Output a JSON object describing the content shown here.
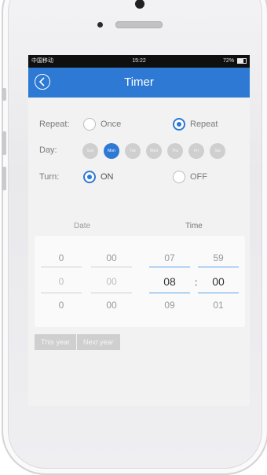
{
  "status_bar": {
    "carrier": "中国移动 ",
    "time": "15:22",
    "battery": "72%"
  },
  "nav": {
    "title": "Timer",
    "back_icon": "chevron-left-icon"
  },
  "repeat": {
    "label": "Repeat:",
    "options": [
      {
        "label": "Once",
        "selected": false
      },
      {
        "label": "Repeat",
        "selected": true
      }
    ]
  },
  "day": {
    "label": "Day:",
    "items": [
      {
        "label": "Sun",
        "selected": false
      },
      {
        "label": "Mon",
        "selected": true
      },
      {
        "label": "Tue",
        "selected": false
      },
      {
        "label": "Wed",
        "selected": false
      },
      {
        "label": "Thu",
        "selected": false
      },
      {
        "label": "Fri",
        "selected": false
      },
      {
        "label": "Sat",
        "selected": false
      }
    ]
  },
  "turn": {
    "label": "Turn:",
    "options": [
      {
        "label": "ON",
        "selected": true
      },
      {
        "label": "OFF",
        "selected": false
      }
    ]
  },
  "picker": {
    "date_header": "Date",
    "time_header": "Time",
    "columns": [
      {
        "values": [
          "0",
          "0",
          "0"
        ]
      },
      {
        "values": [
          "00",
          "00",
          "00"
        ]
      },
      {
        "values": [
          "07",
          "08",
          "09"
        ]
      },
      {
        "values": [
          "59",
          "00",
          "01"
        ]
      }
    ],
    "separator": ":"
  },
  "year_tabs": [
    "This year",
    "Next year"
  ],
  "colors": {
    "accent": "#2d79d4",
    "status_bar": "#0f0f0f",
    "background": "#f2f2f2"
  }
}
